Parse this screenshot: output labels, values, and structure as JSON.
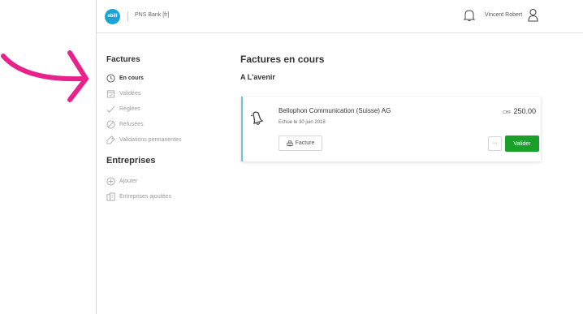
{
  "colors": {
    "accent_pink": "#e8228c",
    "accent_purple": "#9b3fb8",
    "logo_blue": "#1aa3d9",
    "valider_green": "#19a028",
    "card_border": "#6cc4d8"
  },
  "topbar": {
    "logo_text": "ebill",
    "bank_name": "PNS Bank [fr]",
    "user_name": "Vincent Robert"
  },
  "sidebar": {
    "factures_title": "Factures",
    "factures_items": [
      {
        "label": "En cours",
        "icon": "clock-icon",
        "active": true
      },
      {
        "label": "Validées",
        "icon": "calendar-icon",
        "active": false
      },
      {
        "label": "Réglées",
        "icon": "check-icon",
        "active": false
      },
      {
        "label": "Refusées",
        "icon": "blocked-icon",
        "active": false
      },
      {
        "label": "Validations permanentes",
        "icon": "tag-icon",
        "active": false
      }
    ],
    "entreprises_title": "Entreprises",
    "entreprises_items": [
      {
        "label": "Ajouter",
        "icon": "plus-circle-icon"
      },
      {
        "label": "Entreprises ajoutées",
        "icon": "building-icon"
      }
    ]
  },
  "main": {
    "title": "Factures en cours",
    "section": "A L'avenir"
  },
  "invoice": {
    "company": "Bellophon Communication (Suisse) AG",
    "due": "Echue le 30 juin 2018",
    "currency": "CHF",
    "amount": "250.00",
    "facture_label": "Facture",
    "more_label": "···",
    "valider_label": "Valider"
  }
}
